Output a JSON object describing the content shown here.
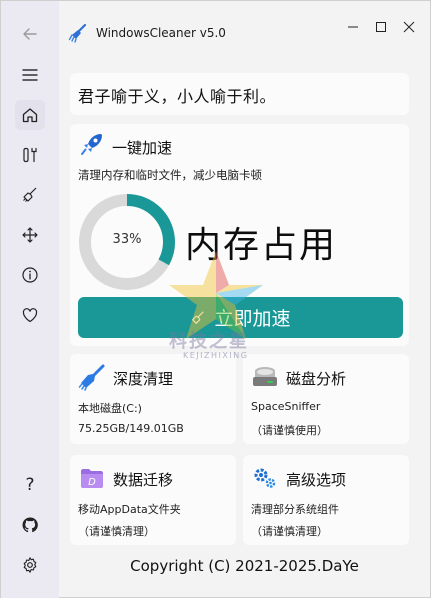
{
  "window": {
    "title": "WindowsCleaner v5.0"
  },
  "sidebar": {
    "items": [
      {
        "name": "back",
        "icon": "arrow-left-icon"
      },
      {
        "name": "menu",
        "icon": "hamburger-icon"
      },
      {
        "name": "home",
        "icon": "home-icon",
        "active": true
      },
      {
        "name": "tools",
        "icon": "tools-icon"
      },
      {
        "name": "clean",
        "icon": "broom-icon"
      },
      {
        "name": "move",
        "icon": "move-arrows-icon"
      },
      {
        "name": "about",
        "icon": "info-icon"
      },
      {
        "name": "favorite",
        "icon": "heart-icon"
      },
      {
        "name": "help",
        "icon": "question-icon"
      },
      {
        "name": "github",
        "icon": "github-icon"
      },
      {
        "name": "settings",
        "icon": "gear-icon"
      }
    ],
    "help_glyph": "?"
  },
  "quote": {
    "text": "君子喻于义，小人喻于利。"
  },
  "speedup": {
    "title": "一键加速",
    "description": "清理内存和临时文件，减少电脑卡顿",
    "memory_percent": 33,
    "memory_percent_label": "33%",
    "memory_label": "内存占用",
    "button_label": "立即加速"
  },
  "tiles": {
    "deep_clean": {
      "title": "深度清理",
      "line1": "本地磁盘(C:)",
      "line2": "75.25GB/149.01GB"
    },
    "disk_analysis": {
      "title": "磁盘分析",
      "line1": "SpaceSniffer",
      "line2": "（请谨慎使用）"
    },
    "data_migration": {
      "title": "数据迁移",
      "line1": "移动AppData文件夹",
      "line2": "（请谨慎清理）"
    },
    "advanced": {
      "title": "高级选项",
      "line1": "清理部分系统组件",
      "line2": "（请谨慎清理）"
    }
  },
  "footer": {
    "copyright": "Copyright (C) 2021-2025.DaYe"
  },
  "watermark": {
    "cn": "科技之星",
    "en": "KEJIZHIXING"
  },
  "colors": {
    "accent": "#1a9898",
    "gauge_track": "#d9d9d9",
    "sidebar_bg": "#ebeaf3",
    "window_bg": "#f3f3f3"
  }
}
